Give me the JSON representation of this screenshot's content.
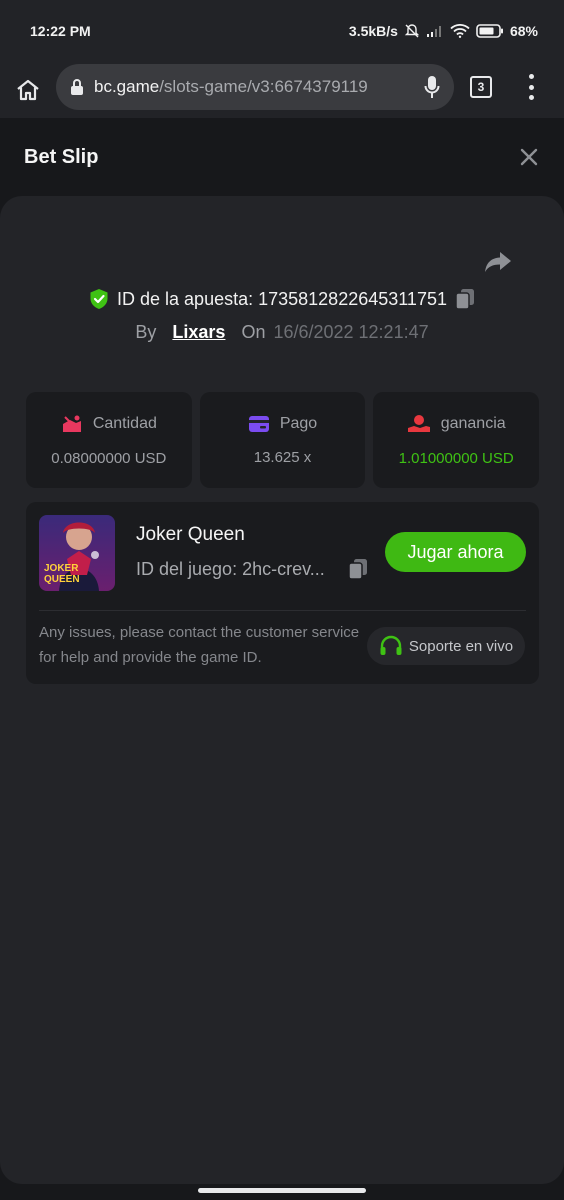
{
  "status_bar": {
    "time": "12:22 PM",
    "net_speed": "3.5kB/s",
    "battery": "68%"
  },
  "browser": {
    "url_domain": "bc.game",
    "url_path": "/slots-game/v3:6674379119",
    "tab_count": "3"
  },
  "header": {
    "title": "Bet Slip"
  },
  "bet": {
    "id_label": "ID de la apuesta: 1735812822645311751",
    "by_label": "By",
    "user": "Lixars",
    "on_label": "On",
    "date": "16/6/2022 12:21:47"
  },
  "stats": [
    {
      "label": "Cantidad",
      "value": "0.08000000 USD",
      "icon": "amount-icon"
    },
    {
      "label": "Pago",
      "value": "13.625 x",
      "icon": "card-icon"
    },
    {
      "label": "ganancia",
      "value": "1.01000000 USD",
      "icon": "profit-icon"
    }
  ],
  "game": {
    "name": "Joker Queen",
    "id_text": "ID del juego: 2hc-crev...",
    "thumb_text_1": "JOKER",
    "thumb_text_2": "QUEEN",
    "play_label": "Jugar ahora",
    "help_text": "Any issues, please contact the customer service for help and provide the game ID.",
    "support_label": "Soporte en vivo"
  },
  "colors": {
    "accent_green": "#3fb913",
    "profit_green": "#3fc214",
    "amount_pink": "#e8385f",
    "card_purple": "#7b4cf0",
    "profit_red": "#e8383f"
  }
}
